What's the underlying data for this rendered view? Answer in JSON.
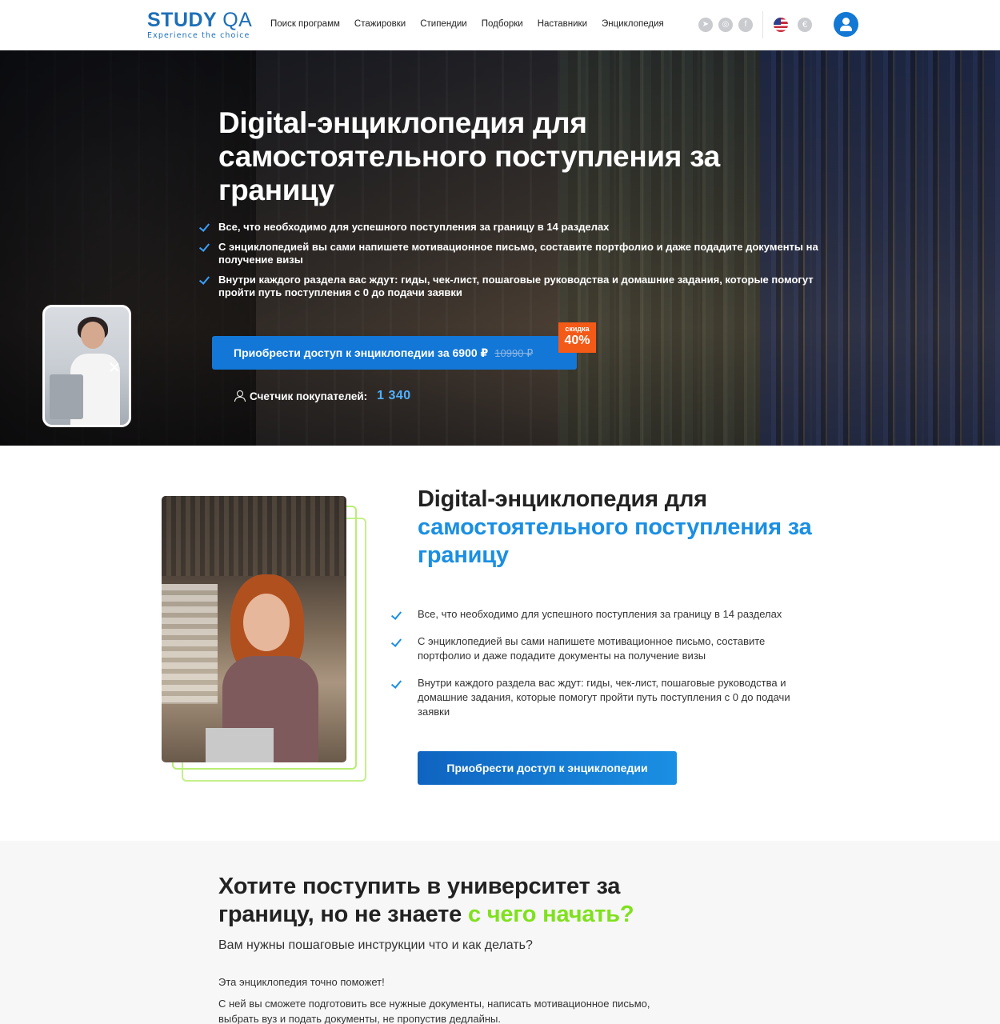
{
  "header": {
    "logo_main": "STUDY",
    "logo_qa": "QA",
    "logo_tagline": "Experience the choice",
    "nav": [
      "Поиск программ",
      "Стажировки",
      "Стипендии",
      "Подборки",
      "Наставники",
      "Энциклопедия"
    ],
    "socials": [
      "telegram-icon",
      "instagram-icon",
      "facebook-icon"
    ],
    "currency_symbol": "€"
  },
  "hero": {
    "title": "Digital-энциклопедия для самостоятельного поступления за границу",
    "bullets": [
      "Все, что необходимо для успешного поступления за границу в 14 разделах",
      "С энциклопедией вы сами напишете мотивационное письмо, составите портфолио и даже подадите документы на получение визы",
      "Внутри каждого раздела вас ждут: гиды, чек-лист, пошаговые руководства и домашние задания, которые помогут пройти путь поступления с 0 до подачи заявки"
    ],
    "cta_label": "Приобрести доступ к энциклопедии за 6900 ₽",
    "cta_old_price": "10990 ₽",
    "discount_label": "скидка",
    "discount_value": "40%",
    "counter_label": "Счетчик покупателей:",
    "counter_value": "1 340"
  },
  "section2": {
    "title_dark": "Digital-энциклопедия для",
    "title_blue": "самостоятельного поступления за границу",
    "bullets": [
      "Все, что необходимо для успешного поступления за границу в 14 разделах",
      "С энциклопедией вы сами напишете мотивационное письмо, составите портфолио и даже подадите документы на получение визы",
      "Внутри каждого раздела вас ждут: гиды, чек-лист, пошаговые руководства и домашние задания, которые помогут пройти путь поступления с 0 до подачи заявки"
    ],
    "cta_label": "Приобрести доступ к энциклопедии"
  },
  "section3": {
    "title_dark": "Хотите поступить в университет за границу, но не знаете",
    "title_green": "с чего начать?",
    "subtitle": "Вам нужны пошаговые инструкции что и как делать?",
    "p1": "Эта энциклопедия точно поможет!",
    "p2": "С ней вы сможете подготовить все нужные документы, написать мотивационное письмо, выбрать вуз и подать документы, не пропустив дедлайны."
  },
  "colors": {
    "brand_blue": "#1277d6",
    "accent_blue": "#1a8fe3",
    "accent_green": "#7fe11d",
    "discount_orange": "#f45a17"
  }
}
